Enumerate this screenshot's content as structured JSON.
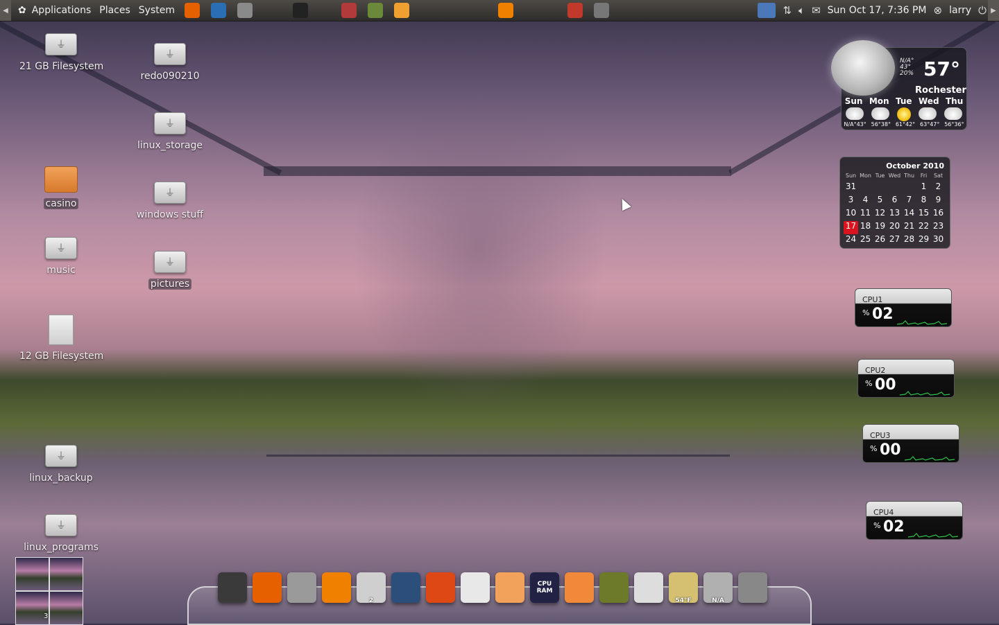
{
  "top_panel": {
    "menus": [
      "Applications",
      "Places",
      "System"
    ],
    "launchers": [
      {
        "icon": "firefox-icon",
        "color": "#e66000"
      },
      {
        "icon": "thunderbird-icon",
        "color": "#2a6fb5"
      },
      {
        "icon": "screenshot-icon",
        "color": "#8a8a8a"
      },
      {
        "icon": "terminal-icon",
        "color": "#222222"
      },
      {
        "icon": "archive-icon",
        "color": "#b33a3a"
      },
      {
        "icon": "synaptic-icon",
        "color": "#6a8a3a"
      },
      {
        "icon": "sound-juicer-icon",
        "color": "#f0a030"
      },
      {
        "icon": "vlc-icon",
        "color": "#f08000"
      },
      {
        "icon": "solitaire-icon",
        "color": "#c0392b"
      },
      {
        "icon": "games-icon",
        "color": "#777777"
      }
    ],
    "tray": {
      "clock": "Sun Oct 17,  7:36 PM",
      "user": "larry",
      "icons": [
        "weather-applet-icon",
        "network-icon",
        "volume-icon",
        "mail-icon",
        "user-icon",
        "power-icon"
      ]
    }
  },
  "desktop_icons": [
    {
      "label": "21 GB Filesystem",
      "type": "drive"
    },
    {
      "label": "redo090210",
      "type": "drive"
    },
    {
      "label": "linux_storage",
      "type": "drive"
    },
    {
      "label": "casino",
      "type": "folder"
    },
    {
      "label": "windows stuff",
      "type": "drive"
    },
    {
      "label": "music",
      "type": "drive"
    },
    {
      "label": "pictures",
      "type": "drive"
    },
    {
      "label": "12 GB Filesystem",
      "type": "file"
    },
    {
      "label": "linux_backup",
      "type": "drive"
    },
    {
      "label": "linux_programs",
      "type": "drive"
    }
  ],
  "weather": {
    "temp": "57°",
    "na_label": "N/A°",
    "low": "43°",
    "humidity": "20%",
    "city": "Rochester",
    "days": [
      "Sun",
      "Mon",
      "Tue",
      "Wed",
      "Thu"
    ],
    "conditions": [
      "cloud",
      "cloud",
      "sun",
      "cloud",
      "cloud"
    ],
    "temps": [
      "N/A°43°",
      "56°38°",
      "61°42°",
      "63°47°",
      "56°36°"
    ]
  },
  "calendar": {
    "title": "October 2010",
    "weekdays": [
      "Sun",
      "Mon",
      "Tue",
      "Wed",
      "Thu",
      "Fri",
      "Sat"
    ],
    "cells": [
      "31",
      "",
      "",
      "",
      "",
      "1",
      "2",
      "3",
      "4",
      "5",
      "6",
      "7",
      "8",
      "9",
      "10",
      "11",
      "12",
      "13",
      "14",
      "15",
      "16",
      "17",
      "18",
      "19",
      "20",
      "21",
      "22",
      "23",
      "24",
      "25",
      "26",
      "27",
      "28",
      "29",
      "30"
    ],
    "today": "17"
  },
  "cpu_monitors": [
    {
      "label": "CPU1",
      "value": "02"
    },
    {
      "label": "CPU2",
      "value": "00"
    },
    {
      "label": "CPU3",
      "value": "00"
    },
    {
      "label": "CPU4",
      "value": "02"
    }
  ],
  "workspaces": {
    "current_number": "3"
  },
  "dock": {
    "items": [
      {
        "icon": "terminal-icon",
        "color": "#3a3a3a",
        "text": "",
        "sub": ""
      },
      {
        "icon": "firefox-icon",
        "color": "#e66000",
        "text": "",
        "sub": ""
      },
      {
        "icon": "calculator-icon",
        "color": "#9a9a9a",
        "text": "",
        "sub": ""
      },
      {
        "icon": "vlc-icon",
        "color": "#f08000",
        "text": "",
        "sub": ""
      },
      {
        "icon": "trash-icon",
        "color": "#cfcfcf",
        "text": "",
        "sub": "2"
      },
      {
        "icon": "desktop-icon",
        "color": "#2c4e7a",
        "text": "",
        "sub": ""
      },
      {
        "icon": "ubuntu-icon",
        "color": "#dd4814",
        "text": "",
        "sub": ""
      },
      {
        "icon": "text-editor-icon",
        "color": "#e8e8e8",
        "text": "",
        "sub": ""
      },
      {
        "icon": "files-icon",
        "color": "#f2a25a",
        "text": "",
        "sub": ""
      },
      {
        "icon": "system-monitor-icon",
        "color": "#222244",
        "text": "CPU RAM",
        "sub": ""
      },
      {
        "icon": "downloads-icon",
        "color": "#f08a3a",
        "text": "",
        "sub": ""
      },
      {
        "icon": "image-viewer-icon",
        "color": "#6c7a2a",
        "text": "",
        "sub": ""
      },
      {
        "icon": "shutdown-icon",
        "color": "#dddddd",
        "text": "",
        "sub": ""
      },
      {
        "icon": "weather-moon-icon",
        "color": "#d4c070",
        "text": "",
        "sub": "54°F"
      },
      {
        "icon": "globe-icon",
        "color": "#b0b0b0",
        "text": "",
        "sub": "N/A"
      },
      {
        "icon": "speaker-icon",
        "color": "#888888",
        "text": "",
        "sub": ""
      }
    ]
  }
}
